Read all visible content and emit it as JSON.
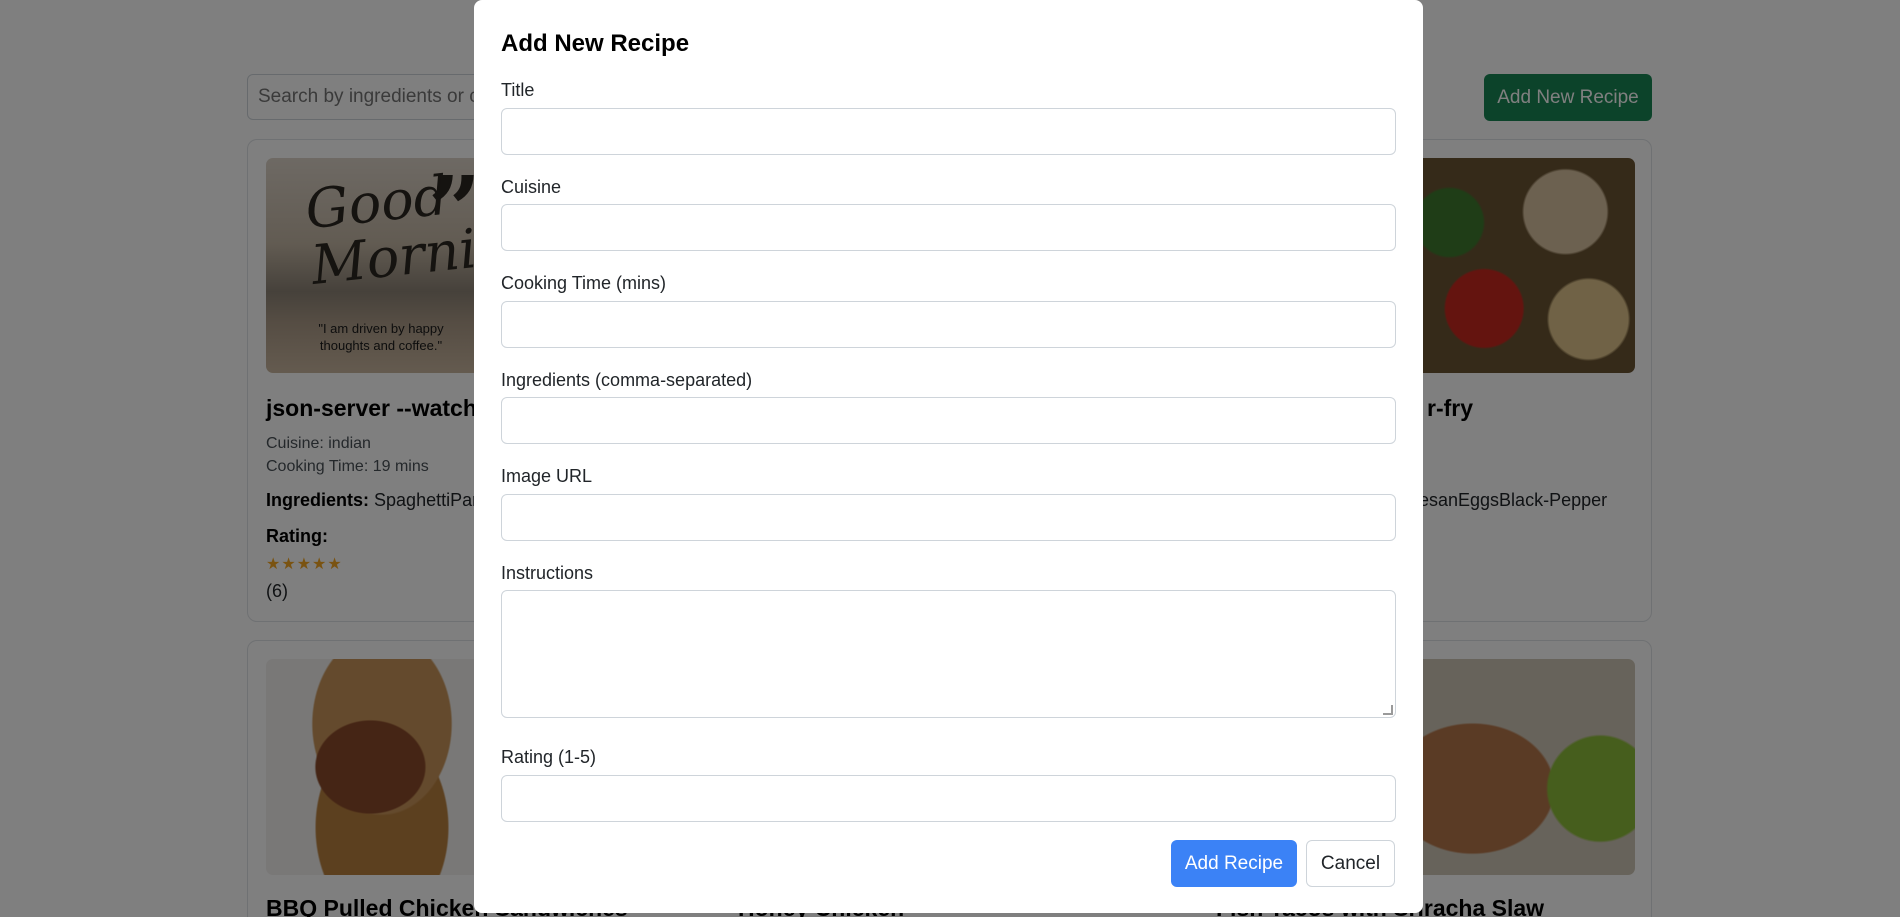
{
  "background": {
    "search": {
      "placeholder": "Search by ingredients or cuisine"
    },
    "add_button": "Add New Recipe",
    "cards": [
      {
        "title": "json-server --watch",
        "cuisine": "Cuisine: indian",
        "time": "Cooking Time: 19 mins",
        "ingredients_label": "Ingredients:",
        "ingredients": "SpaghettiPar",
        "rating_label": "Rating:",
        "stars": "★★★★★",
        "count": "(6)",
        "image_caption": "\"I am driven by happy thoughts and coffee.\"",
        "image_script": "Good Morning"
      },
      {
        "title_tail": "r-fry",
        "ingredients_tail": "mesanEggsBlack-Pepper"
      },
      {
        "title": "BBQ Pulled Chicken Sandwiches"
      },
      {
        "title": "Honey Chicken"
      },
      {
        "title": "Fish Tacos with Sriracha Slaw"
      }
    ]
  },
  "modal": {
    "title": "Add New Recipe",
    "fields": [
      {
        "label": "Title",
        "value": ""
      },
      {
        "label": "Cuisine",
        "value": ""
      },
      {
        "label": "Cooking Time (mins)",
        "value": ""
      },
      {
        "label": "Ingredients (comma-separated)",
        "value": ""
      },
      {
        "label": "Image URL",
        "value": ""
      },
      {
        "label": "Instructions",
        "value": ""
      },
      {
        "label": "Rating (1-5)",
        "value": ""
      }
    ],
    "submit_label": "Add Recipe",
    "cancel_label": "Cancel"
  },
  "colors": {
    "primary": "#3b82f6",
    "success": "#198754",
    "star": "#f5a623",
    "backdrop": "rgba(0,0,0,0.5)"
  }
}
